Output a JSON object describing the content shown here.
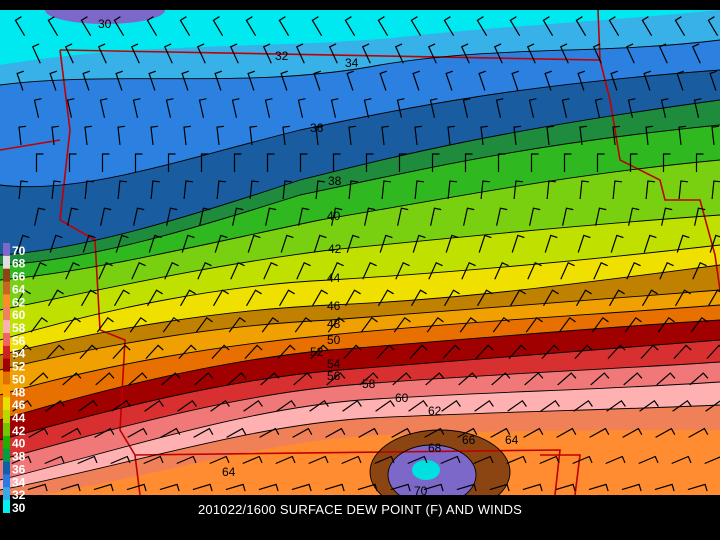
{
  "caption": "201022/1600 SURFACE DEW POINT (F) AND WINDS",
  "colorbar": {
    "labels": [
      "70",
      "68",
      "66",
      "64",
      "62",
      "60",
      "58",
      "56",
      "54",
      "52",
      "50",
      "48",
      "46",
      "44",
      "42",
      "40",
      "38",
      "36",
      "34",
      "32",
      "30"
    ],
    "colors": [
      "#7b68c8",
      "#e0e0e0",
      "#8b4513",
      "#c86428",
      "#ff8c28",
      "#f08060",
      "#ffb0b0",
      "#f06464",
      "#d02020",
      "#a00000",
      "#e07000",
      "#ffa000",
      "#e8e000",
      "#b8d800",
      "#70c800",
      "#20b000",
      "#00a040",
      "#1060a8",
      "#2c7ae0",
      "#38a8e8",
      "#00f0f0"
    ]
  },
  "contour_labels": [
    {
      "text": "30"
    },
    {
      "text": "32"
    },
    {
      "text": "34"
    },
    {
      "text": "36"
    },
    {
      "text": "38"
    },
    {
      "text": "40"
    },
    {
      "text": "42"
    },
    {
      "text": "44"
    },
    {
      "text": "46"
    },
    {
      "text": "48"
    },
    {
      "text": "50"
    },
    {
      "text": "52"
    },
    {
      "text": "54"
    },
    {
      "text": "56"
    },
    {
      "text": "58"
    },
    {
      "text": "60"
    },
    {
      "text": "62"
    },
    {
      "text": "64"
    },
    {
      "text": "64"
    },
    {
      "text": "66"
    },
    {
      "text": "68"
    },
    {
      "text": "70"
    }
  ]
}
